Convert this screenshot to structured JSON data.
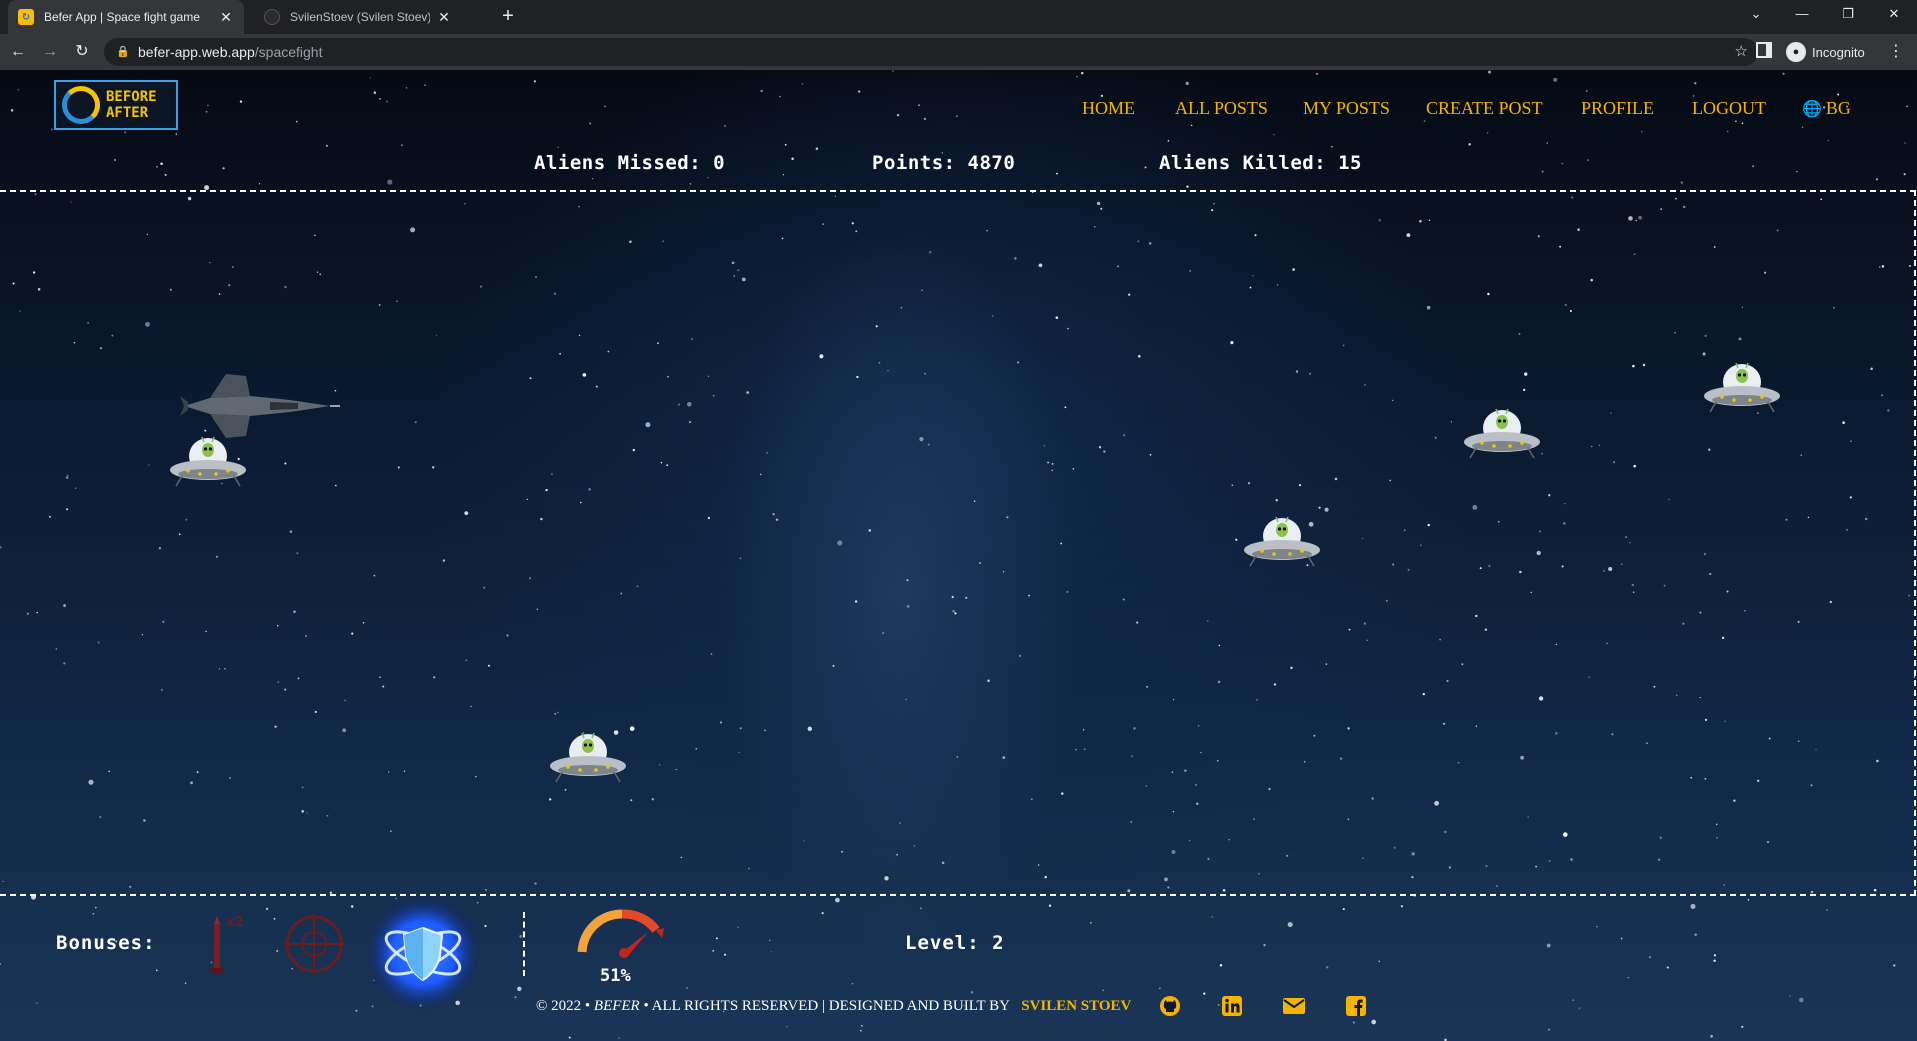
{
  "browser": {
    "tabs": [
      {
        "title": "Befer App | Space fight game",
        "active": true
      },
      {
        "title": "SvilenStoev (Svilen Stoev) - GitHu",
        "active": false
      }
    ],
    "address": {
      "host": "befer-app.web.app",
      "path": "/spacefight"
    },
    "incognito_label": "Incognito"
  },
  "logo": {
    "line1": "BEFORE",
    "line2": "AFTER"
  },
  "nav": {
    "items": [
      "HOME",
      "ALL POSTS",
      "MY POSTS",
      "CREATE POST",
      "PROFILE",
      "LOGOUT"
    ],
    "language": "BG"
  },
  "stats": {
    "aliens_missed": "Aliens Missed: 0",
    "points": "Points: 4870",
    "aliens_killed": "Aliens Killed: 15"
  },
  "game": {
    "player_ship_icon": "fighter-jet-icon",
    "alien_icon": "ufo-alien-icon"
  },
  "hud": {
    "bonuses_label": "Bonuses:",
    "bonuses": [
      {
        "name": "double-missile-icon",
        "badge": "x2",
        "active": false
      },
      {
        "name": "crosshair-icon",
        "active": false
      },
      {
        "name": "shield-icon",
        "active": true
      }
    ],
    "speed_percent": "51%",
    "level": "Level: 2"
  },
  "footer": {
    "copyright": "© 2022 •",
    "brand": "BEFER",
    "rights": "• ALL RIGHTS RESERVED | DESIGNED AND BUILT BY",
    "author": "SVILEN STOEV",
    "social_icons": [
      "github-icon",
      "linkedin-icon",
      "email-icon",
      "facebook-icon"
    ]
  },
  "colors": {
    "accent": "#f5b400",
    "text": "#ffffff",
    "shield_glow": "#1e5bff"
  }
}
